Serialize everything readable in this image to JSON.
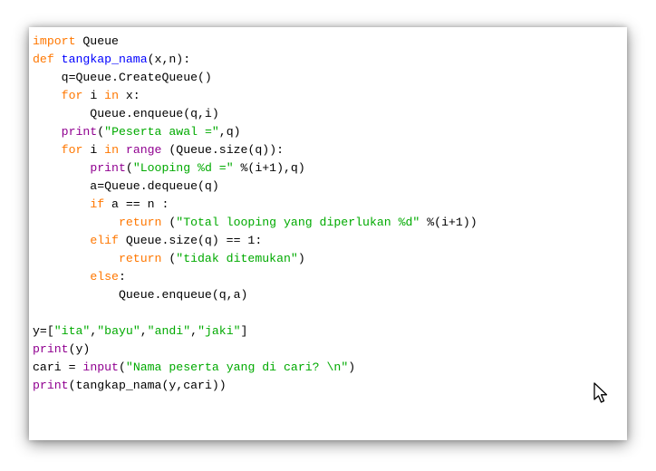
{
  "colors": {
    "keyword": "#ff7700",
    "builtin": "#900090",
    "definition": "#0000ff",
    "string": "#00aa00",
    "plain": "#000000"
  },
  "cursor": {
    "icon": "mouse-pointer-icon"
  },
  "code_lines": [
    [
      {
        "t": "kw",
        "v": "import"
      },
      {
        "t": "plain",
        "v": " Queue"
      }
    ],
    [
      {
        "t": "kw",
        "v": "def"
      },
      {
        "t": "plain",
        "v": " "
      },
      {
        "t": "def",
        "v": "tangkap_nama"
      },
      {
        "t": "plain",
        "v": "(x,n):"
      }
    ],
    [
      {
        "t": "plain",
        "v": "    q=Queue.CreateQueue()"
      }
    ],
    [
      {
        "t": "plain",
        "v": "    "
      },
      {
        "t": "kw",
        "v": "for"
      },
      {
        "t": "plain",
        "v": " i "
      },
      {
        "t": "kw",
        "v": "in"
      },
      {
        "t": "plain",
        "v": " x:"
      }
    ],
    [
      {
        "t": "plain",
        "v": "        Queue.enqueue(q,i)"
      }
    ],
    [
      {
        "t": "plain",
        "v": "    "
      },
      {
        "t": "bi",
        "v": "print"
      },
      {
        "t": "plain",
        "v": "("
      },
      {
        "t": "str",
        "v": "\"Peserta awal =\""
      },
      {
        "t": "plain",
        "v": ",q)"
      }
    ],
    [
      {
        "t": "plain",
        "v": "    "
      },
      {
        "t": "kw",
        "v": "for"
      },
      {
        "t": "plain",
        "v": " i "
      },
      {
        "t": "kw",
        "v": "in"
      },
      {
        "t": "plain",
        "v": " "
      },
      {
        "t": "bi",
        "v": "range"
      },
      {
        "t": "plain",
        "v": " (Queue.size(q)):"
      }
    ],
    [
      {
        "t": "plain",
        "v": "        "
      },
      {
        "t": "bi",
        "v": "print"
      },
      {
        "t": "plain",
        "v": "("
      },
      {
        "t": "str",
        "v": "\"Looping %d =\""
      },
      {
        "t": "plain",
        "v": " %(i+1),q)"
      }
    ],
    [
      {
        "t": "plain",
        "v": "        a=Queue.dequeue(q)"
      }
    ],
    [
      {
        "t": "plain",
        "v": "        "
      },
      {
        "t": "kw",
        "v": "if"
      },
      {
        "t": "plain",
        "v": " a == n :"
      }
    ],
    [
      {
        "t": "plain",
        "v": "            "
      },
      {
        "t": "kw",
        "v": "return"
      },
      {
        "t": "plain",
        "v": " ("
      },
      {
        "t": "str",
        "v": "\"Total looping yang diperlukan %d\""
      },
      {
        "t": "plain",
        "v": " %(i+1))"
      }
    ],
    [
      {
        "t": "plain",
        "v": "        "
      },
      {
        "t": "kw",
        "v": "elif"
      },
      {
        "t": "plain",
        "v": " Queue.size(q) == 1:"
      }
    ],
    [
      {
        "t": "plain",
        "v": "            "
      },
      {
        "t": "kw",
        "v": "return"
      },
      {
        "t": "plain",
        "v": " ("
      },
      {
        "t": "str",
        "v": "\"tidak ditemukan\""
      },
      {
        "t": "plain",
        "v": ")"
      }
    ],
    [
      {
        "t": "plain",
        "v": "        "
      },
      {
        "t": "kw",
        "v": "else"
      },
      {
        "t": "plain",
        "v": ":"
      }
    ],
    [
      {
        "t": "plain",
        "v": "            Queue.enqueue(q,a)"
      }
    ],
    [
      {
        "t": "plain",
        "v": ""
      }
    ],
    [
      {
        "t": "plain",
        "v": "y=["
      },
      {
        "t": "str",
        "v": "\"ita\""
      },
      {
        "t": "plain",
        "v": ","
      },
      {
        "t": "str",
        "v": "\"bayu\""
      },
      {
        "t": "plain",
        "v": ","
      },
      {
        "t": "str",
        "v": "\"andi\""
      },
      {
        "t": "plain",
        "v": ","
      },
      {
        "t": "str",
        "v": "\"jaki\""
      },
      {
        "t": "plain",
        "v": "]"
      }
    ],
    [
      {
        "t": "bi",
        "v": "print"
      },
      {
        "t": "plain",
        "v": "(y)"
      }
    ],
    [
      {
        "t": "plain",
        "v": "cari = "
      },
      {
        "t": "bi",
        "v": "input"
      },
      {
        "t": "plain",
        "v": "("
      },
      {
        "t": "str",
        "v": "\"Nama peserta yang di cari? \\n\""
      },
      {
        "t": "plain",
        "v": ")"
      }
    ],
    [
      {
        "t": "bi",
        "v": "print"
      },
      {
        "t": "plain",
        "v": "(tangkap_nama(y,cari))"
      }
    ]
  ]
}
